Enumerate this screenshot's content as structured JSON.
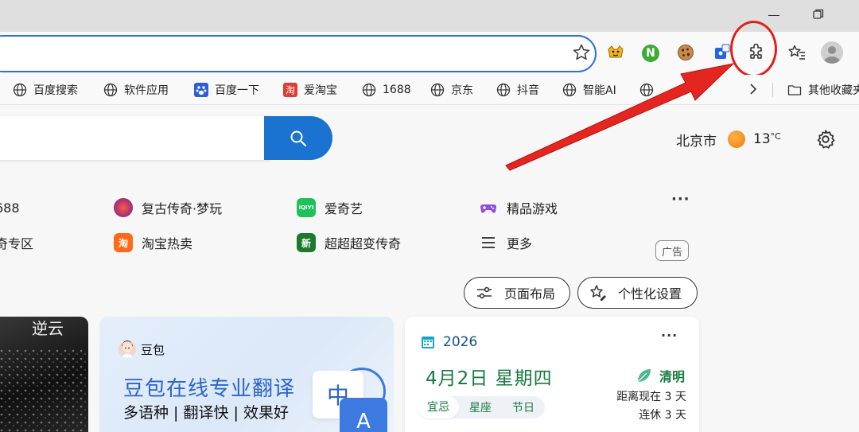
{
  "bookmarks": [
    {
      "label": "百度搜索",
      "icon": "globe-icon"
    },
    {
      "label": "软件应用",
      "icon": "globe-icon"
    },
    {
      "label": "百度一下",
      "icon": "baidu-paw-icon"
    },
    {
      "label": "爱淘宝",
      "icon": "taobao-icon"
    },
    {
      "label": "1688",
      "icon": "globe-icon"
    },
    {
      "label": "京东",
      "icon": "globe-icon"
    },
    {
      "label": "抖音",
      "icon": "globe-icon"
    },
    {
      "label": "智能AI",
      "icon": "globe-icon"
    },
    {
      "label": "其他收藏夹",
      "icon": "folder-icon"
    }
  ],
  "weather": {
    "city": "北京市",
    "temp": "13",
    "unit": "°C"
  },
  "quick_links": {
    "row1": [
      "688",
      "复古传奇·梦玩",
      "爱奇艺",
      "精品游戏"
    ],
    "row2": [
      "奇专区",
      "淘宝热卖",
      "超超超变传奇",
      "更多"
    ],
    "ad_label": "广告",
    "more_dots": "···"
  },
  "buttons": {
    "layout": "页面布局",
    "personalize": "个性化设置"
  },
  "doubao_card": {
    "brand": "豆包",
    "title": "豆包在线专业翻译",
    "subtitle": "多语种 | 翻译快 | 效果好",
    "icon_zh": "中",
    "icon_a": "A"
  },
  "calendar_card": {
    "year": "2026",
    "date": "4月2日 星期四",
    "solar_term": "清明",
    "countdown": "距离现在 3 天",
    "holiday": "连休 3 天",
    "tabs": [
      "宜忌",
      "星座",
      "节日"
    ],
    "more_dots": "···"
  },
  "movie_card": {
    "calligraphy": "逆云"
  },
  "colors": {
    "accent": "#1a73d1",
    "annotation": "#e0201b",
    "calendar_green": "#157a3e",
    "doubao_blue": "#2b64c8"
  }
}
